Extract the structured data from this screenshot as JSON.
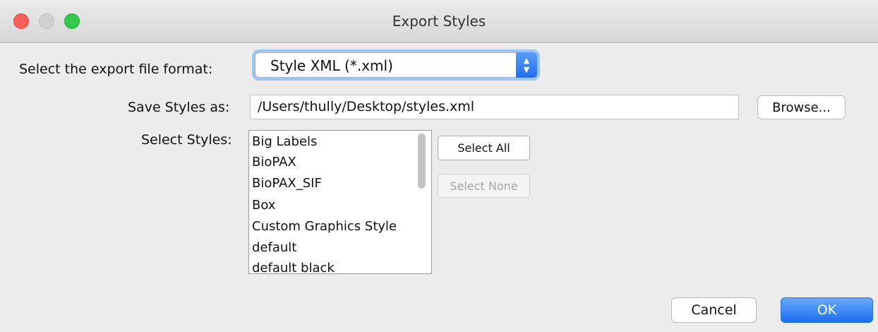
{
  "window": {
    "title": "Export Styles"
  },
  "format": {
    "label": "Select the export file format:",
    "selected": "Style XML (*.xml)",
    "stepper_icon": "up-down-chevron-icon"
  },
  "save": {
    "label": "Save Styles as:",
    "value": "/Users/thully/Desktop/styles.xml",
    "browse_label": "Browse..."
  },
  "styles": {
    "label": "Select Styles:",
    "items": [
      "Big Labels",
      "BioPAX",
      "BioPAX_SIF",
      "Box",
      "Custom Graphics Style",
      "default",
      "default black"
    ],
    "select_all_label": "Select All",
    "select_none_label": "Select None"
  },
  "footer": {
    "cancel_label": "Cancel",
    "ok_label": "OK"
  },
  "colors": {
    "accent": "#1d6ff1",
    "close": "#fc605c",
    "maximize": "#34c84a",
    "window_bg": "#ececec"
  }
}
